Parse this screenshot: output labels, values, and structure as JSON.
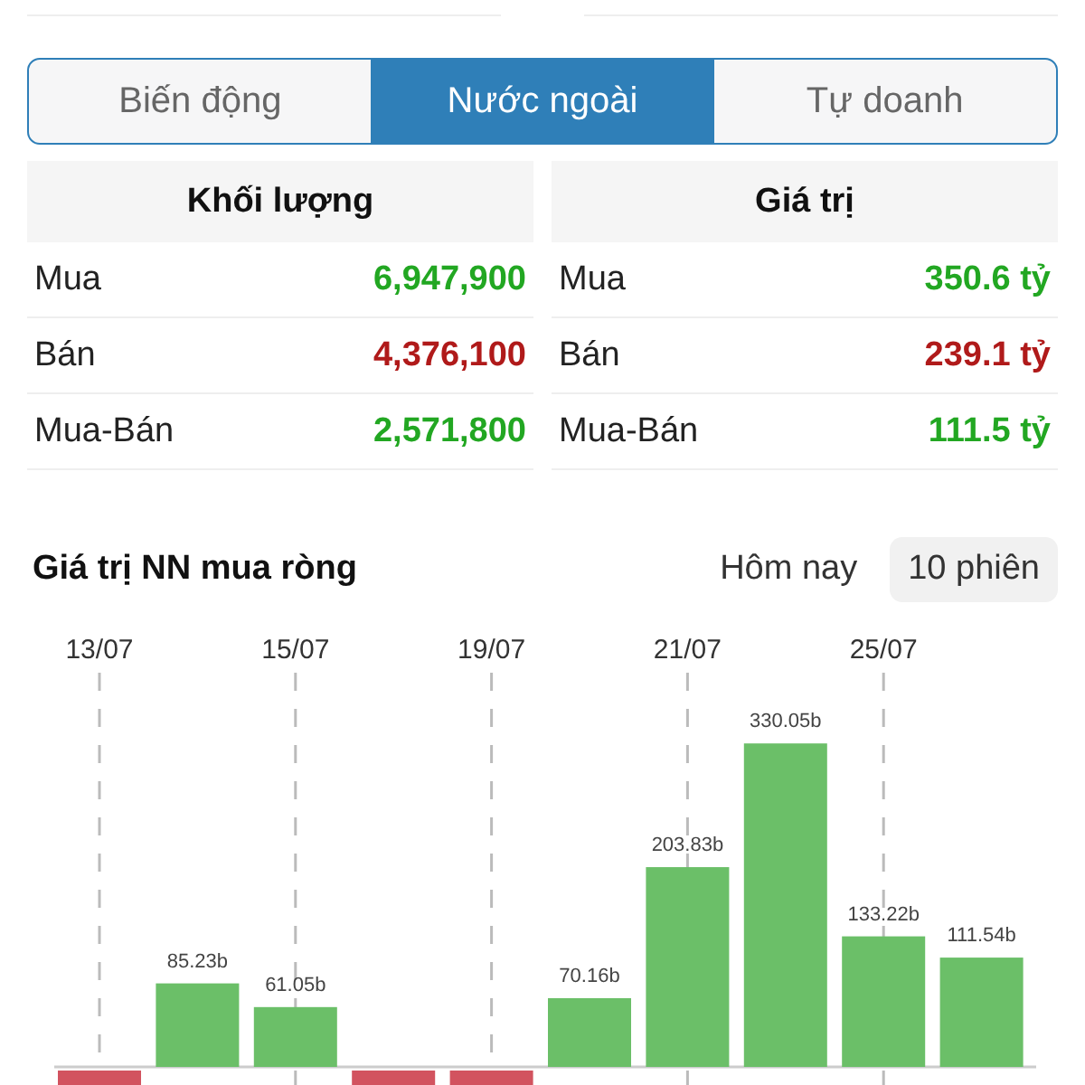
{
  "tabs": [
    {
      "label": "Biến động",
      "selected": false
    },
    {
      "label": "Nước ngoài",
      "selected": true
    },
    {
      "label": "Tự doanh",
      "selected": false
    }
  ],
  "tables": [
    {
      "header": "Khối lượng",
      "rows": [
        {
          "label": "Mua",
          "value": "6,947,900",
          "color": "#22a722"
        },
        {
          "label": "Bán",
          "value": "4,376,100",
          "color": "#b01a1a"
        },
        {
          "label": "Mua-Bán",
          "value": "2,571,800",
          "color": "#22a722"
        }
      ]
    },
    {
      "header": "Giá trị",
      "rows": [
        {
          "label": "Mua",
          "value": "350.6 tỷ",
          "color": "#22a722"
        },
        {
          "label": "Bán",
          "value": "239.1 tỷ",
          "color": "#b01a1a"
        },
        {
          "label": "Mua-Bán",
          "value": "111.5 tỷ",
          "color": "#22a722"
        }
      ]
    }
  ],
  "chart_section": {
    "title": "Giá trị NN mua ròng",
    "periods": [
      {
        "label": "Hôm nay",
        "selected": false
      },
      {
        "label": "10 phiên",
        "selected": true
      }
    ],
    "chart_data": {
      "type": "bar",
      "grid": true,
      "categories": [
        "13/07",
        null,
        "15/07",
        null,
        "19/07",
        null,
        "21/07",
        null,
        "25/07",
        null
      ],
      "values": [
        null,
        85.23,
        61.05,
        null,
        null,
        70.16,
        203.83,
        330.05,
        133.22,
        111.54
      ],
      "value_labels": [
        null,
        "85.23b",
        "61.05b",
        null,
        null,
        "70.16b",
        "203.83b",
        "330.05b",
        "133.22b",
        "111.54b"
      ]
    }
  }
}
